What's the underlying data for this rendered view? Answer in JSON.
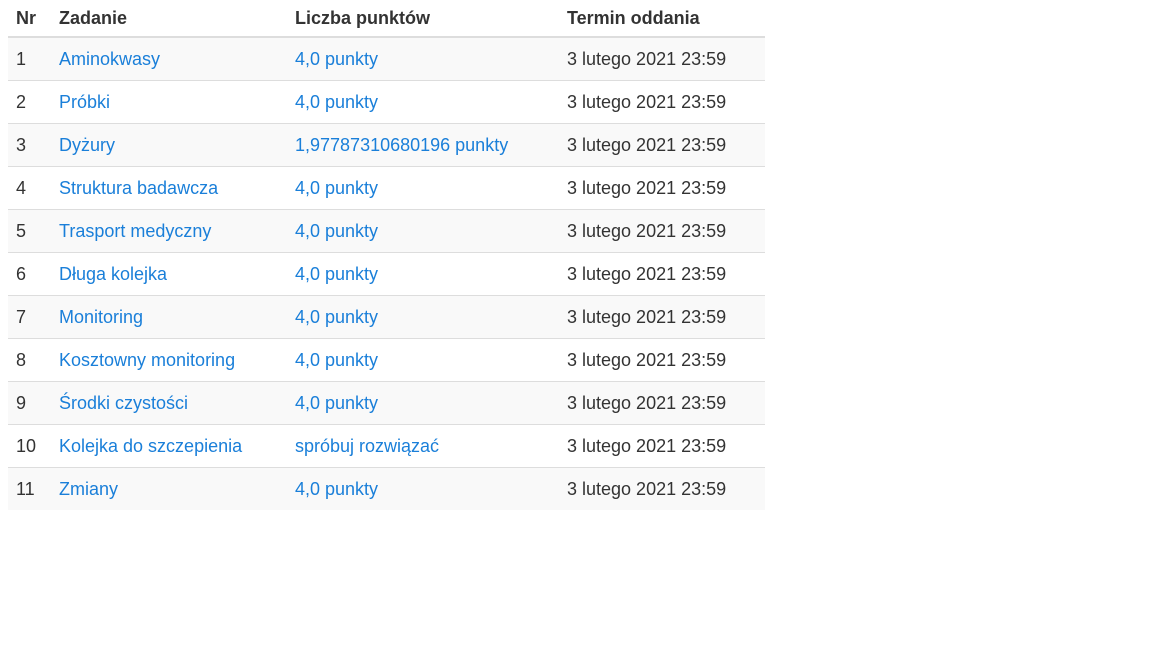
{
  "table": {
    "headers": {
      "nr": "Nr",
      "task": "Zadanie",
      "points": "Liczba punktów",
      "deadline": "Termin oddania"
    },
    "rows": [
      {
        "nr": "1",
        "task": "Aminokwasy",
        "points": "4,0 punkty",
        "deadline": "3 lutego 2021 23:59"
      },
      {
        "nr": "2",
        "task": "Próbki",
        "points": "4,0 punkty",
        "deadline": "3 lutego 2021 23:59"
      },
      {
        "nr": "3",
        "task": "Dyżury",
        "points": "1,97787310680196 punkty",
        "deadline": "3 lutego 2021 23:59"
      },
      {
        "nr": "4",
        "task": "Struktura badawcza",
        "points": "4,0 punkty",
        "deadline": "3 lutego 2021 23:59"
      },
      {
        "nr": "5",
        "task": "Trasport medyczny",
        "points": "4,0 punkty",
        "deadline": "3 lutego 2021 23:59"
      },
      {
        "nr": "6",
        "task": "Długa kolejka",
        "points": "4,0 punkty",
        "deadline": "3 lutego 2021 23:59"
      },
      {
        "nr": "7",
        "task": "Monitoring",
        "points": "4,0 punkty",
        "deadline": "3 lutego 2021 23:59"
      },
      {
        "nr": "8",
        "task": "Kosztowny monitoring",
        "points": "4,0 punkty",
        "deadline": "3 lutego 2021 23:59"
      },
      {
        "nr": "9",
        "task": "Środki czystości",
        "points": "4,0 punkty",
        "deadline": "3 lutego 2021 23:59"
      },
      {
        "nr": "10",
        "task": "Kolejka do szczepienia",
        "points": "spróbuj rozwiązać",
        "deadline": "3 lutego 2021 23:59"
      },
      {
        "nr": "11",
        "task": "Zmiany",
        "points": "4,0 punkty",
        "deadline": "3 lutego 2021 23:59"
      }
    ]
  },
  "colors": {
    "link": "#1a7fd9",
    "text": "#333333",
    "stripe": "#f9f9f9",
    "border": "#dddddd"
  }
}
